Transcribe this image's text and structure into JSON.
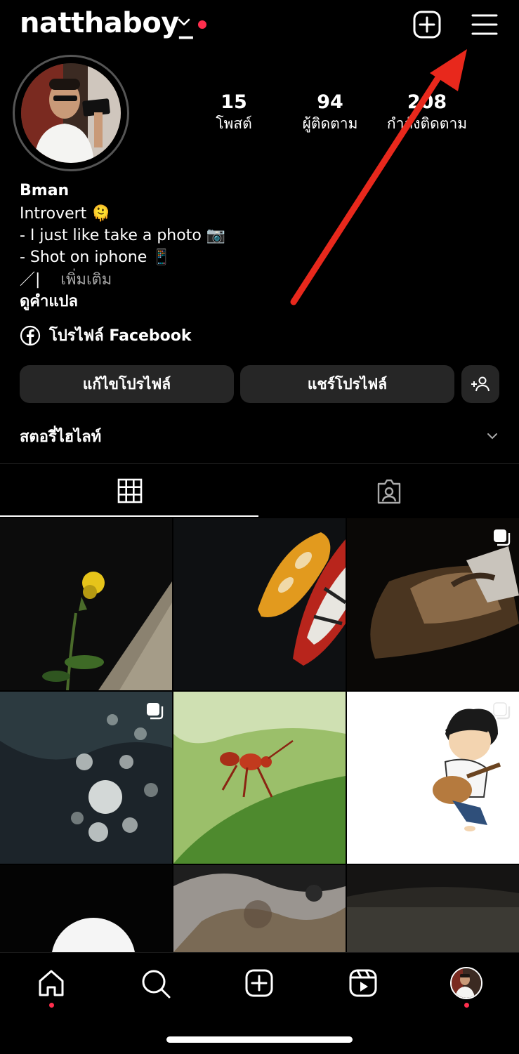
{
  "header": {
    "username": "natthaboy_",
    "icons": {
      "create": "plus-square-icon",
      "menu": "hamburger-menu-icon",
      "accounts": "chevron-down-icon"
    }
  },
  "stats": [
    {
      "value": "15",
      "label": "โพสต์"
    },
    {
      "value": "94",
      "label": "ผู้ติดตาม"
    },
    {
      "value": "208",
      "label": "กำลังติดตาม"
    }
  ],
  "bio": {
    "name": "Bman",
    "line1": "Introvert 🫠",
    "line2": "- I just like take a photo 📷",
    "line3": "- Shot on iphone 📱",
    "line4_prefix": "／|",
    "more": "เพิ่มเติม",
    "translate": "ดูคำแปล",
    "facebook": "โปรไฟล์ Facebook"
  },
  "buttons": {
    "edit": "แก้ไขโปรไฟล์",
    "share": "แชร์โปรไฟล์",
    "add_person_icon": "add-person-icon"
  },
  "highlights": {
    "label": "สตอรี่ไฮไลท์"
  },
  "tabs": {
    "grid_icon": "grid-icon",
    "tagged_icon": "tagged-person-icon"
  },
  "colors": {
    "accent_red": "#ff2e4d",
    "button_bg": "#262626",
    "arrow": "#e8281c"
  },
  "bottom_nav": [
    "home-icon",
    "search-icon",
    "create-icon",
    "reels-icon",
    "profile-avatar"
  ]
}
